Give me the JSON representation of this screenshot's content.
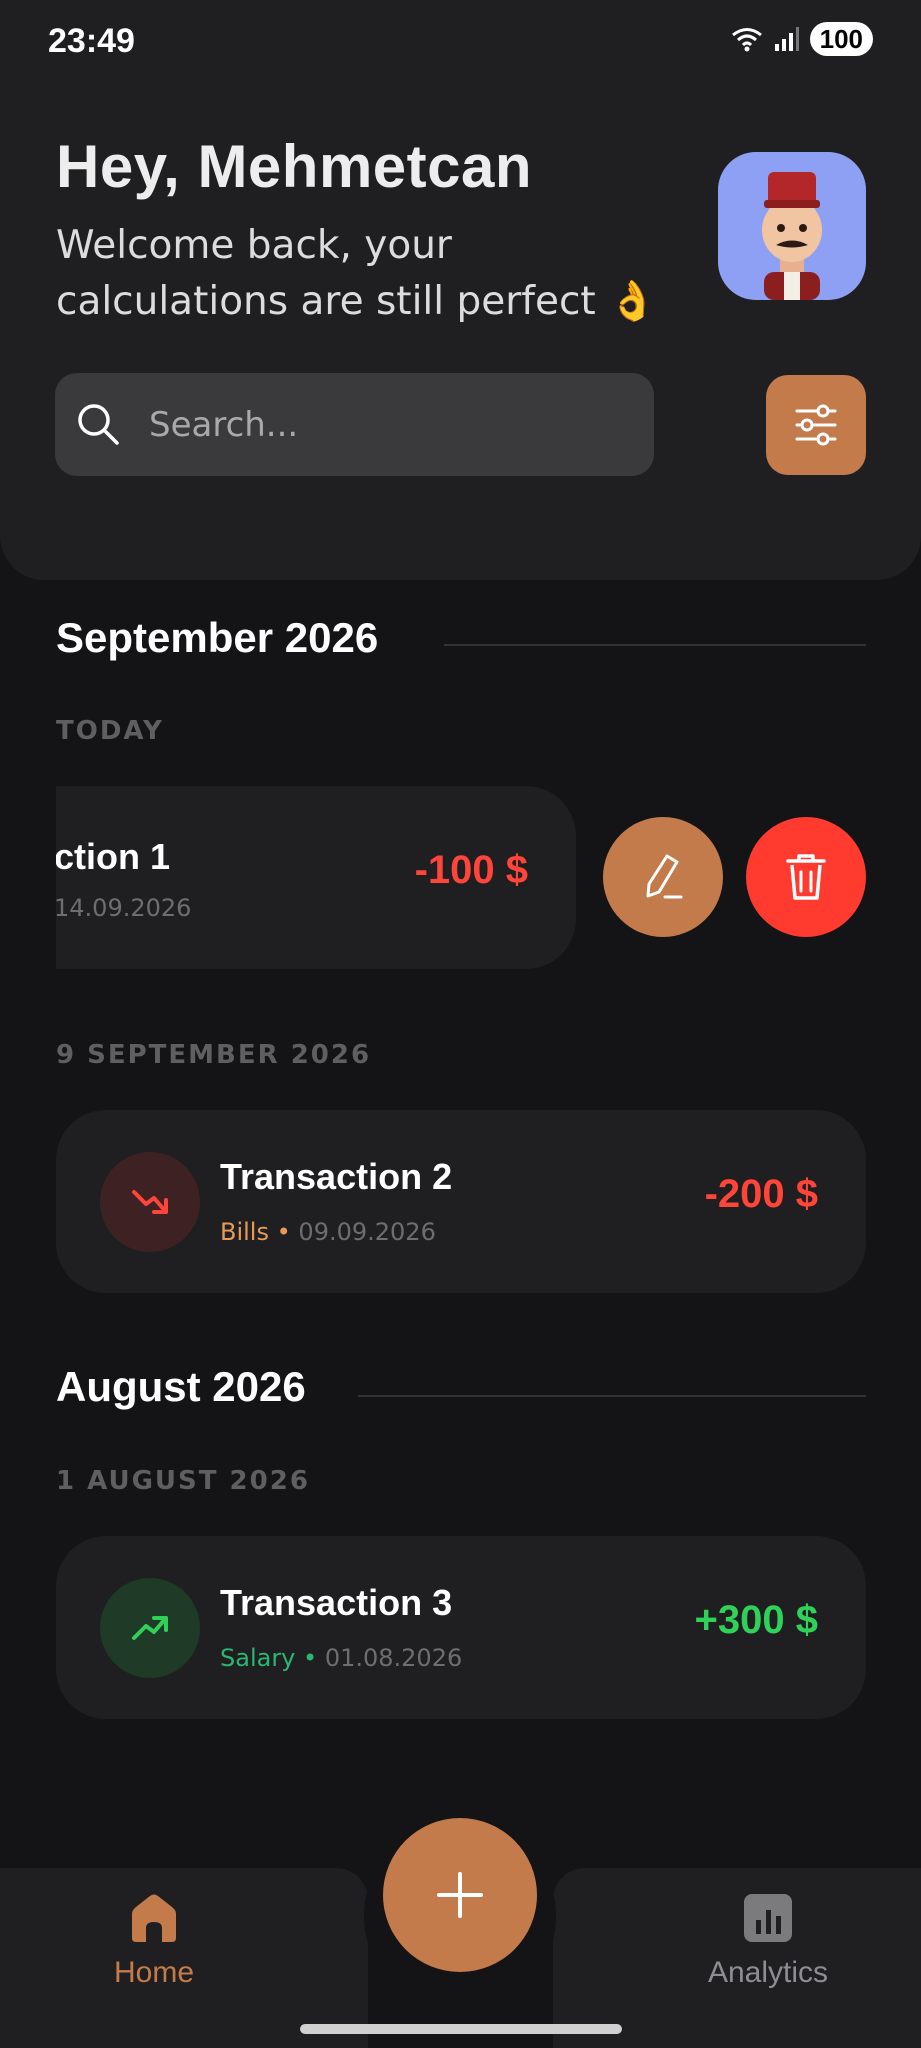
{
  "status_bar": {
    "time": "23:49",
    "battery": "100"
  },
  "header": {
    "greeting": "Hey, Mehmetcan",
    "welcome": "Welcome back, your calculations are still perfect 👌"
  },
  "search": {
    "placeholder": "Search..."
  },
  "sections": [
    {
      "month": "September 2026",
      "groups": [
        {
          "day": "TODAY",
          "transaction": {
            "title": "ction 1",
            "date": "14.09.2026",
            "amount": "-100 $",
            "amount_color": "#ff453a",
            "swiped": true
          }
        },
        {
          "day": "9 SEPTEMBER 2026",
          "transaction": {
            "title": "Transaction 2",
            "category": "Bills",
            "separator": "•",
            "date": "09.09.2026",
            "amount": "-200 $",
            "amount_color": "#ff453a",
            "category_color": "#e89a55",
            "icon": "trend-down-icon"
          }
        }
      ]
    },
    {
      "month": "August 2026",
      "groups": [
        {
          "day": "1 AUGUST 2026",
          "transaction": {
            "title": "Transaction 3",
            "category": "Salary",
            "separator": "•",
            "date": "01.08.2026",
            "amount": "+300 $",
            "amount_color": "#30d158",
            "category_color": "#2bb673",
            "icon": "trend-up-icon"
          }
        }
      ]
    }
  ],
  "bottom_nav": {
    "home_label": "Home",
    "analytics_label": "Analytics",
    "active": "Home",
    "accent": "#c47b4b"
  }
}
